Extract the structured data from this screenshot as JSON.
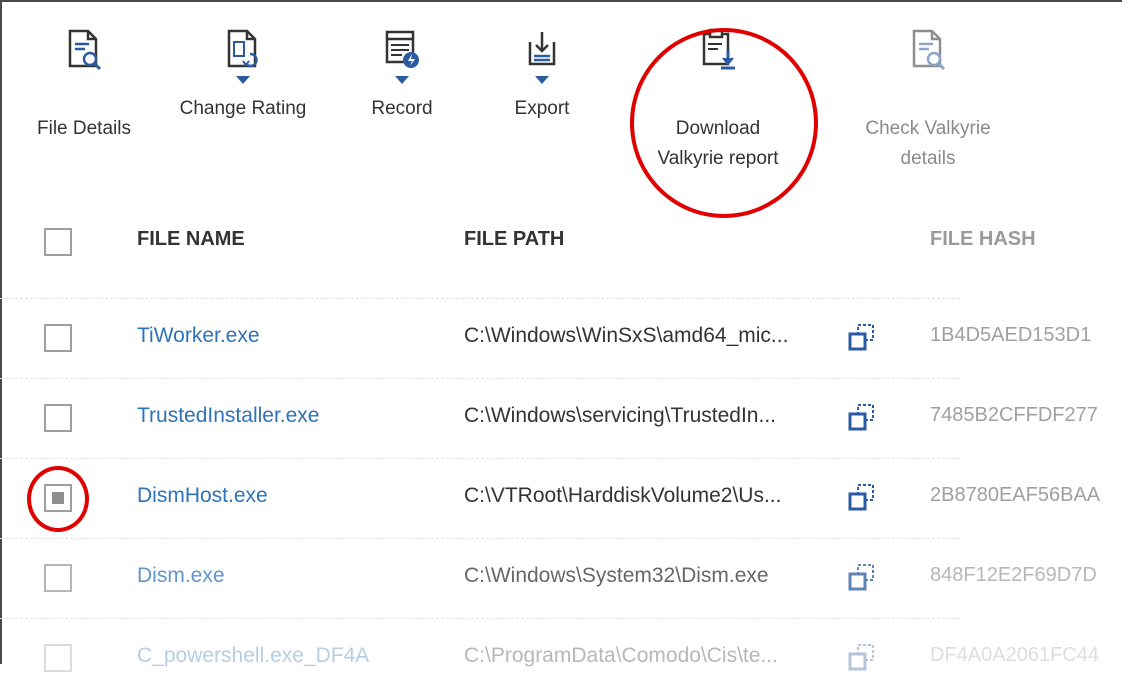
{
  "toolbar": {
    "file_details": "File Details",
    "change_rating": "Change Rating",
    "record": "Record",
    "export": "Export",
    "download_line1": "Download",
    "download_line2": "Valkyrie report",
    "check_line1": "Check Valkyrie",
    "check_line2": "details"
  },
  "table": {
    "headers": {
      "file_name": "FILE NAME",
      "file_path": "FILE PATH",
      "file_hash": "FILE HASH"
    },
    "rows": [
      {
        "name": "TiWorker.exe",
        "path": "C:\\Windows\\WinSxS\\amd64_mic...",
        "hash": "1B4D5AED153D1",
        "checked": false
      },
      {
        "name": "TrustedInstaller.exe",
        "path": "C:\\Windows\\servicing\\TrustedIn...",
        "hash": "7485B2CFFDF277",
        "checked": false
      },
      {
        "name": "DismHost.exe",
        "path": "C:\\VTRoot\\HarddiskVolume2\\Us...",
        "hash": "2B8780EAF56BAA",
        "checked": true
      },
      {
        "name": "Dism.exe",
        "path": "C:\\Windows\\System32\\Dism.exe",
        "hash": "848F12E2F69D7D",
        "checked": false
      },
      {
        "name": "C_powershell.exe_DF4A",
        "path": "C:\\ProgramData\\Comodo\\Cis\\te...",
        "hash": "DF4A0A2061FC44",
        "checked": false
      }
    ]
  },
  "colors": {
    "accent": "#2c5aa0",
    "link": "#2d73b9",
    "annotation": "#e00000"
  },
  "icons": [
    "file-details-icon",
    "change-rating-icon",
    "record-icon",
    "export-icon",
    "download-report-icon",
    "check-valkyrie-icon",
    "copy-icon"
  ]
}
